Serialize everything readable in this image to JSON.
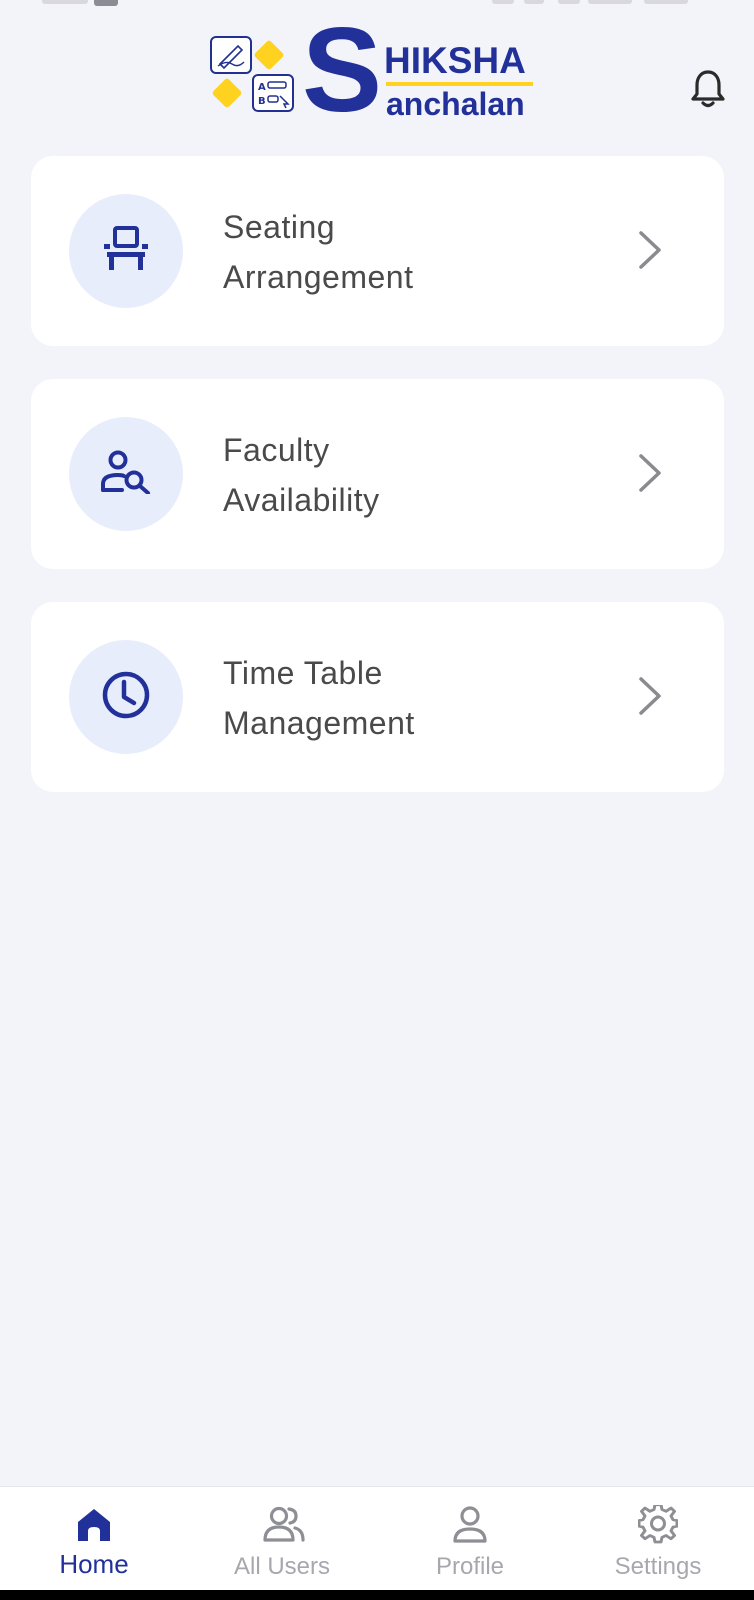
{
  "header": {
    "logo": {
      "big_letter": "S",
      "word_top": "HIKSHA",
      "word_bottom": "anchalan"
    },
    "notification_icon": "bell-icon"
  },
  "menu": [
    {
      "line1": "Seating",
      "line2": "Arrangement",
      "icon": "chair-icon"
    },
    {
      "line1": "Faculty",
      "line2": "Availability",
      "icon": "user-search-icon"
    },
    {
      "line1": "Time Table",
      "line2": "Management",
      "icon": "clock-icon"
    }
  ],
  "bottom_nav": [
    {
      "label": "Home",
      "icon": "home-icon",
      "active": true
    },
    {
      "label": "All Users",
      "icon": "users-icon",
      "active": false
    },
    {
      "label": "Profile",
      "icon": "profile-icon",
      "active": false
    },
    {
      "label": "Settings",
      "icon": "gear-icon",
      "active": false
    }
  ],
  "colors": {
    "brand": "#22319a",
    "accent_yellow": "#ffd21f",
    "background": "#f3f4f9",
    "icon_circle": "#e8edfc",
    "inactive": "#a7a7ae"
  }
}
